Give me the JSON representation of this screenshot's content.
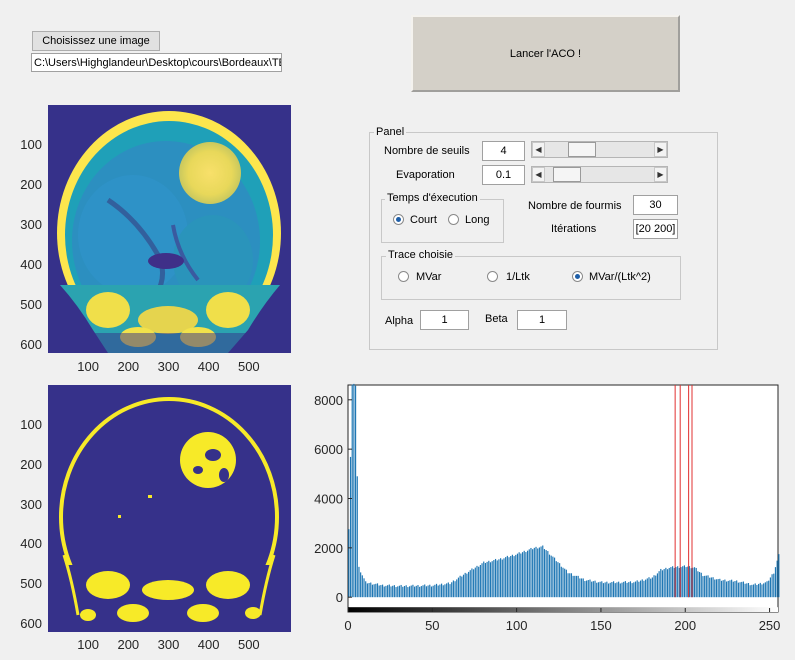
{
  "buttons": {
    "choose_image": "Choisissez une image",
    "launch": "Lancer l'ACO !"
  },
  "path_field": {
    "value": "C:\\Users\\Highglandeur\\Desktop\\cours\\Bordeaux\\TE"
  },
  "panel": {
    "title": "Panel",
    "nombre_seuils": {
      "label": "Nombre de seuils",
      "value": "4",
      "slider_level": 0.28
    },
    "evaporation": {
      "label": "Evaporation",
      "value": "0.1",
      "slider_level": 0.1
    },
    "temps": {
      "title": "Temps d'éxecution",
      "options": [
        "Court",
        "Long"
      ],
      "selected": "Court"
    },
    "fourmis": {
      "label": "Nombre de fourmis",
      "value": "30"
    },
    "iterations": {
      "label": "Itérations",
      "value": "[20 200]"
    },
    "trace": {
      "title": "Trace choisie",
      "options": [
        "MVar",
        "1/Ltk",
        "MVar/(Ltk^2)"
      ],
      "selected": "MVar/(Ltk^2)"
    },
    "alpha": {
      "label": "Alpha",
      "value": "1"
    },
    "beta": {
      "label": "Beta",
      "value": "1"
    }
  },
  "image_axes": {
    "y_ticks": [
      "100",
      "200",
      "300",
      "400",
      "500",
      "600"
    ],
    "x_ticks": [
      "100",
      "200",
      "300",
      "400",
      "500"
    ]
  },
  "chart_data": {
    "type": "bar",
    "title": "",
    "xlabel": "",
    "ylabel": "",
    "xlim": [
      0,
      255
    ],
    "ylim": [
      -600,
      8600
    ],
    "x_ticks": [
      "0",
      "50",
      "100",
      "150",
      "200",
      "250"
    ],
    "y_ticks": [
      "0",
      "2000",
      "4000",
      "6000",
      "8000"
    ],
    "bar_color": "#1f77b4",
    "threshold_color": "#e03030",
    "thresholds": [
      194,
      197,
      202,
      204
    ],
    "histogram_control_points": [
      [
        0,
        2800
      ],
      [
        2,
        8600
      ],
      [
        4,
        8600
      ],
      [
        6,
        1200
      ],
      [
        10,
        600
      ],
      [
        20,
        480
      ],
      [
        30,
        450
      ],
      [
        40,
        460
      ],
      [
        50,
        480
      ],
      [
        60,
        560
      ],
      [
        70,
        1000
      ],
      [
        80,
        1400
      ],
      [
        90,
        1550
      ],
      [
        100,
        1750
      ],
      [
        110,
        2000
      ],
      [
        115,
        2050
      ],
      [
        120,
        1700
      ],
      [
        130,
        1000
      ],
      [
        140,
        700
      ],
      [
        150,
        600
      ],
      [
        160,
        600
      ],
      [
        170,
        620
      ],
      [
        180,
        800
      ],
      [
        185,
        1100
      ],
      [
        190,
        1200
      ],
      [
        200,
        1250
      ],
      [
        205,
        1200
      ],
      [
        210,
        900
      ],
      [
        220,
        700
      ],
      [
        230,
        650
      ],
      [
        240,
        500
      ],
      [
        248,
        600
      ],
      [
        252,
        1000
      ],
      [
        255,
        1700
      ]
    ]
  }
}
